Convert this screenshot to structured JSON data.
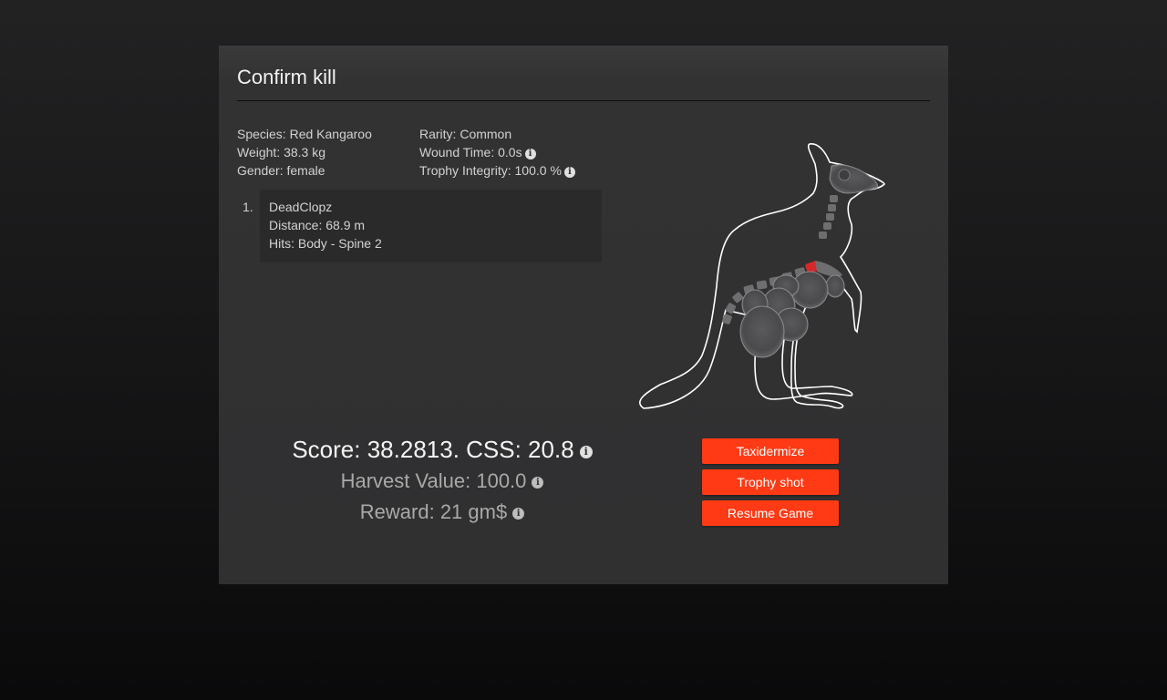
{
  "dialog": {
    "title": "Confirm kill"
  },
  "stats": {
    "species": "Species: Red Kangaroo",
    "weight": "Weight: 38.3 kg",
    "gender": "Gender: female",
    "rarity": "Rarity: Common",
    "wound_time": "Wound Time: 0.0s",
    "trophy_integrity": "Trophy Integrity: 100.0 %"
  },
  "hunters": [
    {
      "index": "1.",
      "name": "DeadClopz",
      "distance": "Distance: 68.9 m",
      "hits": "Hits: Body - Spine 2"
    }
  ],
  "results": {
    "score": "Score: 38.2813. CSS: 20.8",
    "harvest_value": "Harvest Value: 100.0",
    "reward": "Reward: 21 gm$"
  },
  "buttons": {
    "taxidermize": "Taxidermize",
    "trophy_shot": "Trophy shot",
    "resume": "Resume Game"
  },
  "icons": {
    "info": "info-icon",
    "animal": "kangaroo-hit-diagram"
  },
  "colors": {
    "accent": "#ff3a14",
    "hit_marker": "#d8282a",
    "panel": "#303031"
  }
}
